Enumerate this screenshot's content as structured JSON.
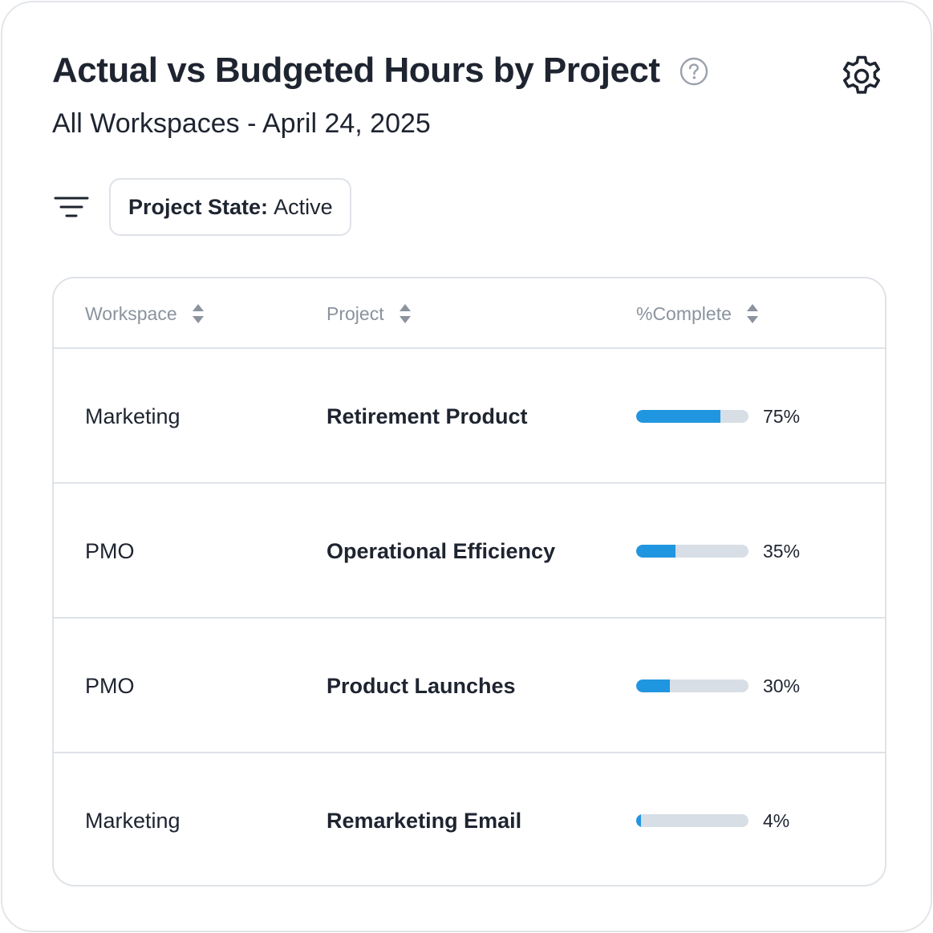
{
  "header": {
    "title": "Actual vs Budgeted Hours by Project",
    "subtitle": "All Workspaces - April 24, 2025",
    "help_icon": "question-circle-icon",
    "settings_icon": "gear-icon"
  },
  "filter": {
    "icon": "filter-lines-icon",
    "chip_key": "Project State:",
    "chip_value": "Active"
  },
  "table": {
    "columns": [
      {
        "label": "Workspace",
        "sort_icon": "sort-updown-icon"
      },
      {
        "label": "Project",
        "sort_icon": "sort-updown-icon"
      },
      {
        "label": "%Complete",
        "sort_icon": "sort-updown-icon"
      }
    ],
    "rows": [
      {
        "workspace": "Marketing",
        "project": "Retirement Product",
        "percent": 75,
        "percent_label": "75%"
      },
      {
        "workspace": "PMO",
        "project": "Operational Efficiency",
        "percent": 35,
        "percent_label": "35%"
      },
      {
        "workspace": "PMO",
        "project": "Product Launches",
        "percent": 30,
        "percent_label": "30%"
      },
      {
        "workspace": "Marketing",
        "project": "Remarketing Email",
        "percent": 4,
        "percent_label": "4%"
      }
    ]
  },
  "colors": {
    "progress_fill": "#2196e0",
    "progress_track": "#d8dee6",
    "border": "#dfe3e8",
    "header_text": "#8b939e"
  }
}
